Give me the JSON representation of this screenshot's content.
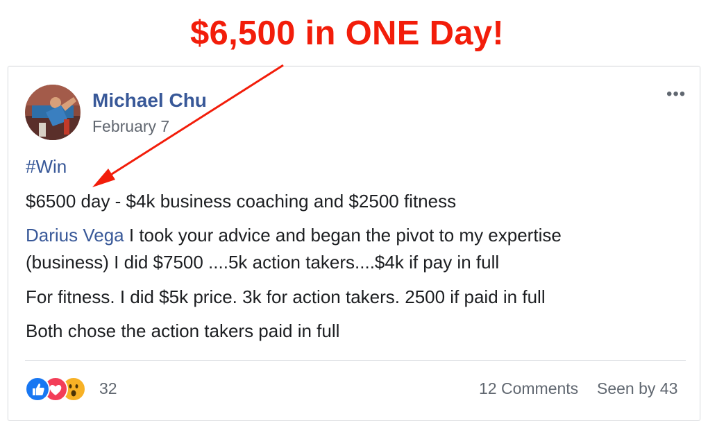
{
  "annotation": {
    "headline": "$6,500 in ONE Day!",
    "color": "#f21d0a"
  },
  "post": {
    "author": "Michael Chu",
    "date": "February 7",
    "more_label": "•••",
    "hashtag": "#Win",
    "line1": "$6500 day - $4k business coaching and $2500 fitness",
    "mention": "Darius Vega",
    "line2a": " I took your advice and began the pivot to my expertise",
    "line2b": "(business) I did $7500 ....5k action takers....$4k if pay in full",
    "line3": "For fitness. I did $5k price. 3k for action takers. 2500 if paid in full",
    "line4": "Both chose the action takers paid in full"
  },
  "footer": {
    "reaction_icons": [
      "like-icon",
      "love-icon",
      "wow-icon"
    ],
    "reaction_count": "32",
    "comments": "12 Comments",
    "seen": "Seen by 43"
  },
  "colors": {
    "link": "#385898",
    "like": "#1877f2",
    "love": "#f33e58",
    "wow": "#f7b125"
  }
}
